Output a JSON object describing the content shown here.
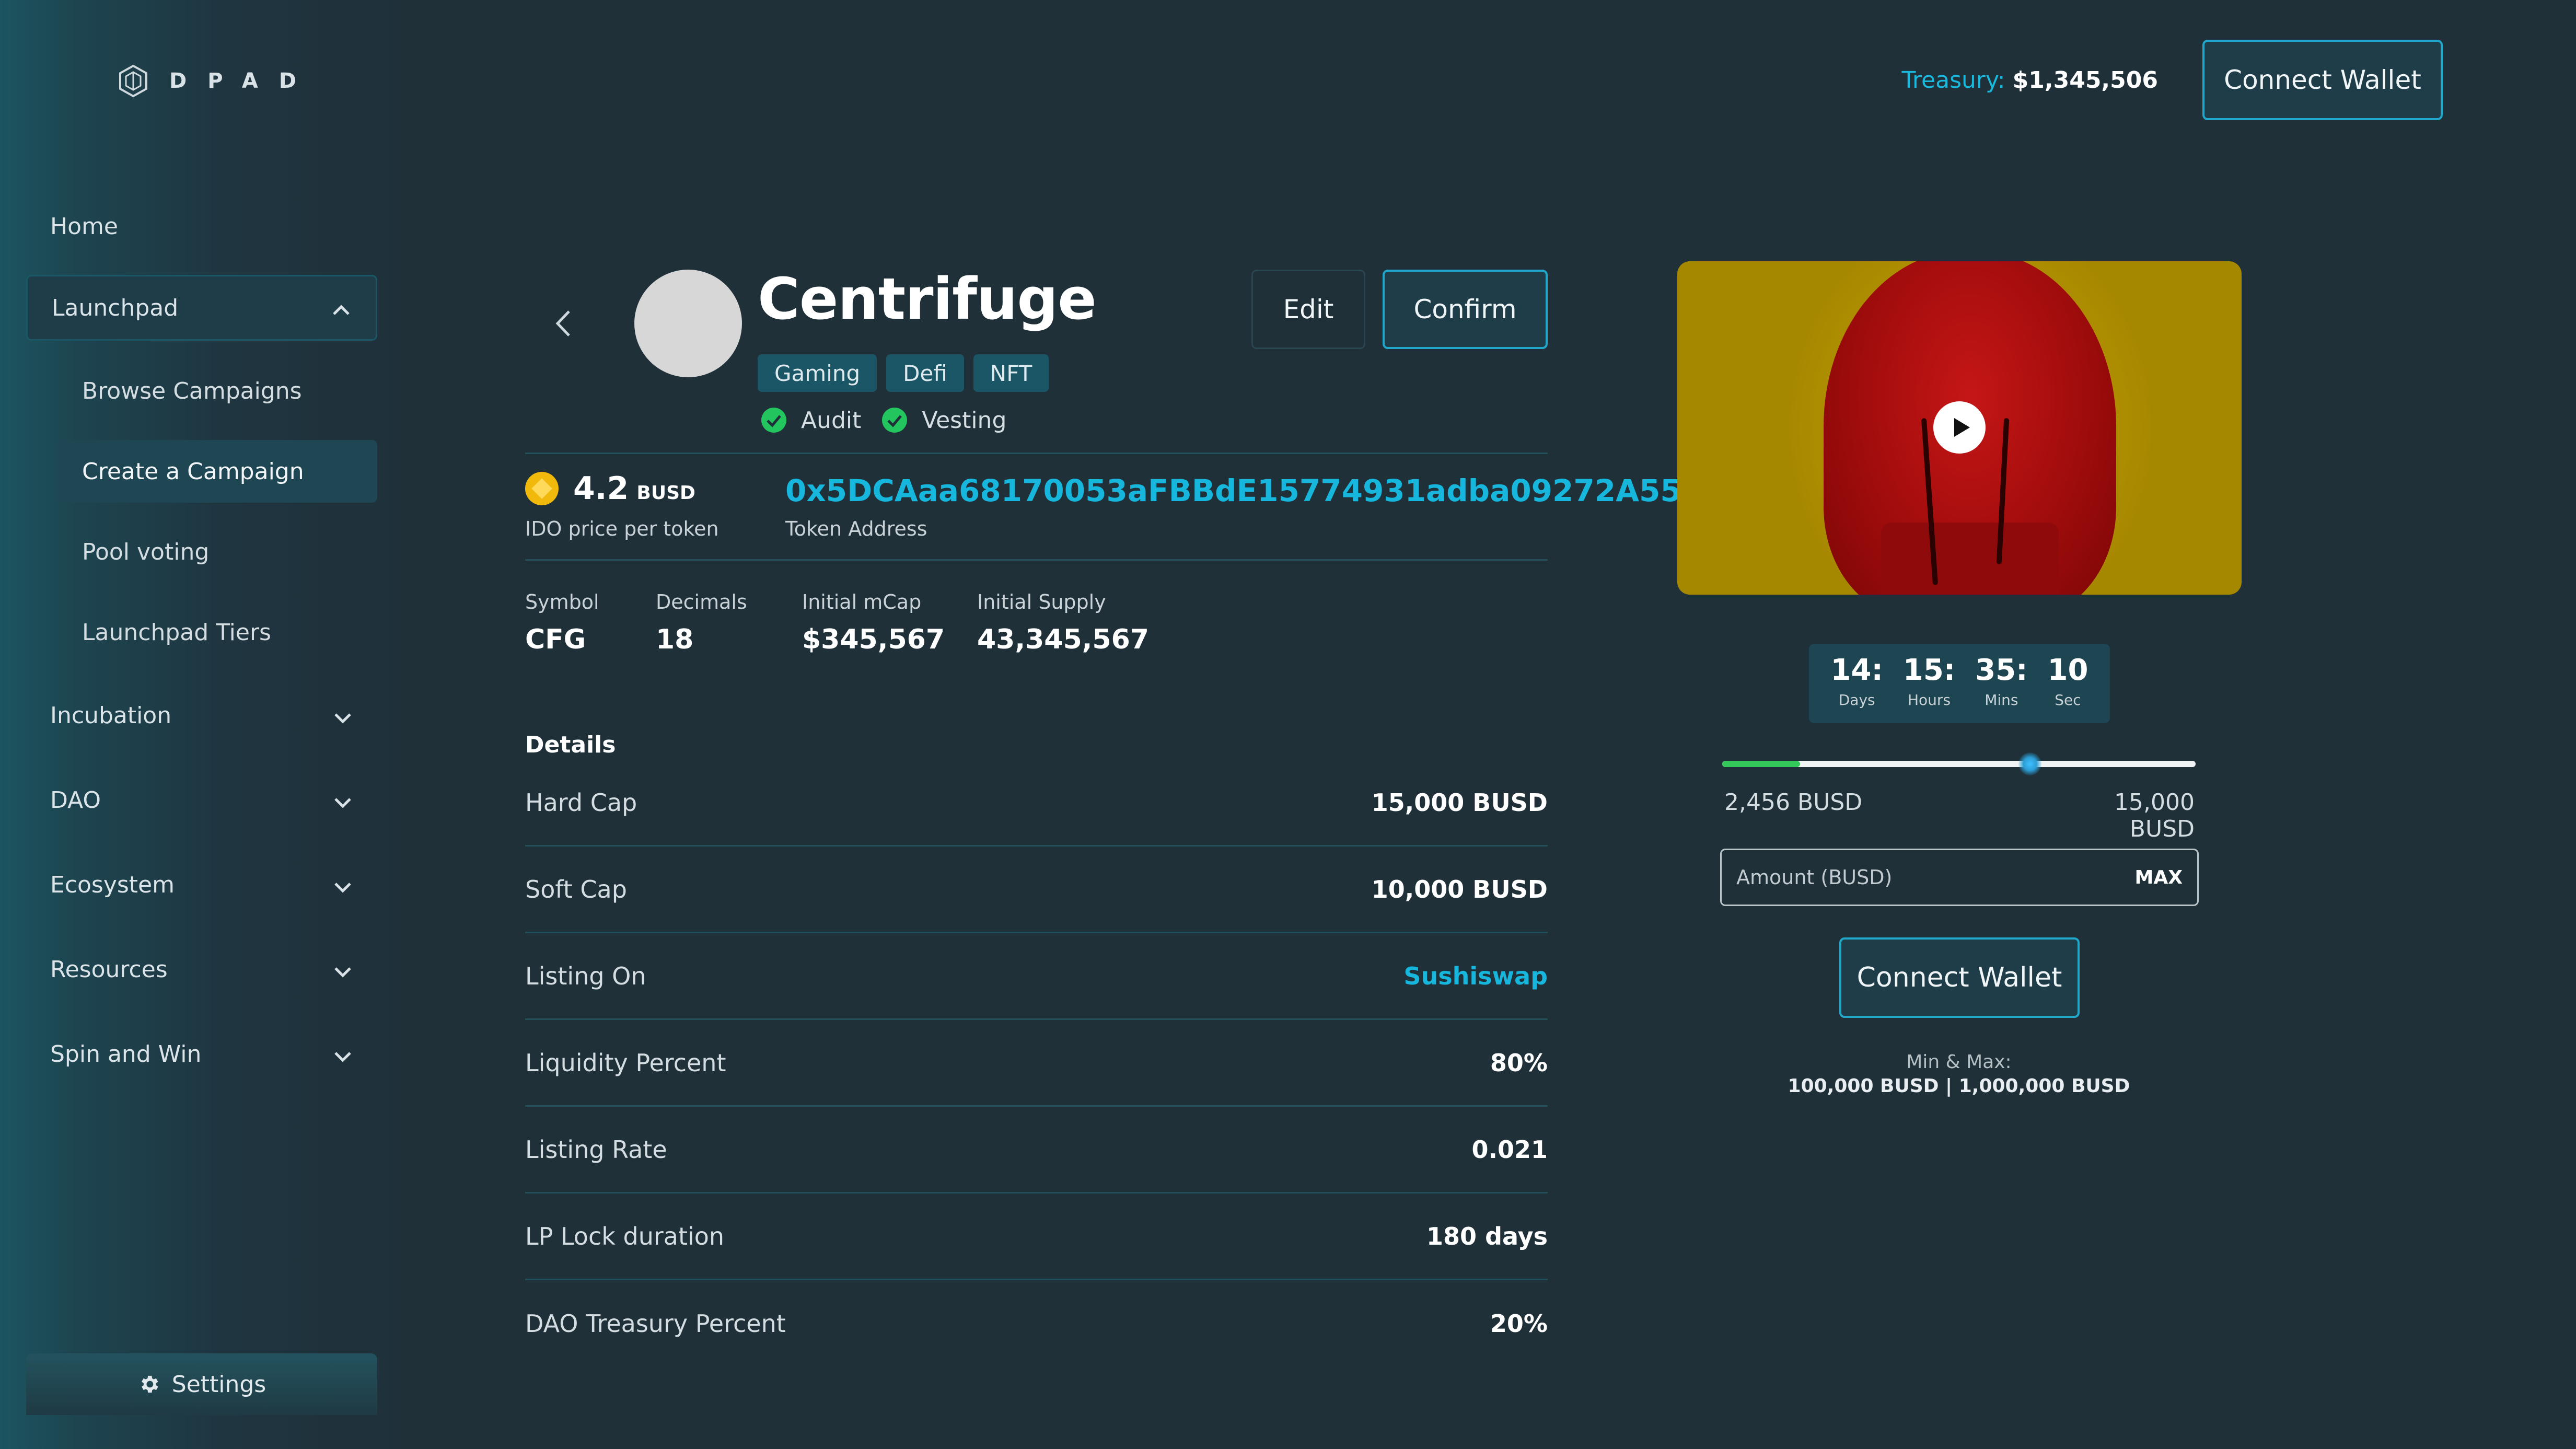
{
  "brand": {
    "name": "DPAD",
    "logo_icon": "cube-logo-icon"
  },
  "sidebar": {
    "home": "Home",
    "launchpad": "Launchpad",
    "launchpad_items": [
      "Browse Campaigns",
      "Create a Campaign",
      "Pool voting",
      "Launchpad Tiers"
    ],
    "active_item": "Create a Campaign",
    "collapsed": [
      "Incubation",
      "DAO",
      "Ecosystem",
      "Resources",
      "Spin and Win"
    ],
    "settings": "Settings"
  },
  "header": {
    "treasury_label": "Treasury:",
    "treasury_value": "$1,345,506",
    "connect_wallet": "Connect Wallet"
  },
  "project": {
    "name": "Centrifuge",
    "tags": [
      "Gaming",
      "Defi",
      "NFT"
    ],
    "checks": [
      "Audit",
      "Vesting"
    ],
    "edit": "Edit",
    "confirm": "Confirm",
    "price": "4.2",
    "price_unit": "BUSD",
    "price_label": "IDO price per token",
    "token_address": "0x5DCAaa68170053aFBBdE15774931adba09272A55",
    "token_address_label": "Token Address",
    "stats": [
      {
        "label": "Symbol",
        "value": "CFG"
      },
      {
        "label": "Decimals",
        "value": "18"
      },
      {
        "label": "Initial mCap",
        "value": "$345,567"
      },
      {
        "label": "Initial Supply",
        "value": "43,345,567"
      }
    ],
    "details_heading": "Details",
    "details": [
      {
        "label": "Hard Cap",
        "value": "15,000 BUSD"
      },
      {
        "label": "Soft Cap",
        "value": "10,000 BUSD"
      },
      {
        "label": "Listing On",
        "value": "Sushiswap"
      },
      {
        "label": "Liquidity Percent",
        "value": "80%"
      },
      {
        "label": "Listing Rate",
        "value": "0.021"
      },
      {
        "label": "LP Lock duration",
        "value": "180 days"
      },
      {
        "label": "DAO Treasury Percent",
        "value": "20%"
      }
    ]
  },
  "sale": {
    "timer": [
      {
        "n": "14:",
        "u": "Days"
      },
      {
        "n": "15:",
        "u": "Hours"
      },
      {
        "n": "35:",
        "u": "Mins"
      },
      {
        "n": "10",
        "u": "Sec"
      }
    ],
    "progress_fraction": 0.164,
    "progress_marker_fraction": 0.65,
    "progress_min": "2,456 BUSD",
    "progress_max": "15,000 BUSD",
    "amount_placeholder": "Amount (BUSD)",
    "max_label": "MAX",
    "connect_wallet": "Connect Wallet",
    "minmax_label": "Min & Max:",
    "minmax_value": "100,000 BUSD |  1,000,000 BUSD"
  },
  "colors": {
    "background": "#1f3039",
    "accent": "#16b6dd",
    "success": "#34c759",
    "tag_bg": "#1b5667"
  }
}
